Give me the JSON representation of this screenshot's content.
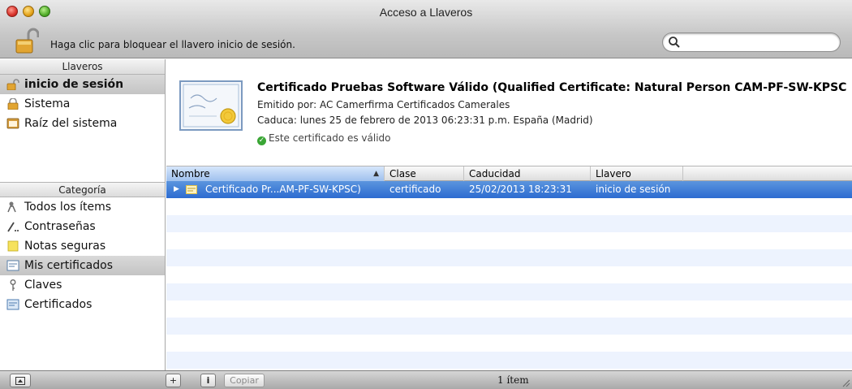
{
  "window": {
    "title": "Acceso a Llaveros"
  },
  "toolbar": {
    "lock_label": "Haga clic para bloquear el llavero inicio de sesión.",
    "search_placeholder": ""
  },
  "sidebar": {
    "keychains_header": "Llaveros",
    "keychains": [
      {
        "label": "inicio de sesión",
        "icon": "open-lock-icon",
        "selected": true
      },
      {
        "label": "Sistema",
        "icon": "lock-icon"
      },
      {
        "label": "Raíz del sistema",
        "icon": "cabinet-icon"
      }
    ],
    "category_header": "Categoría",
    "categories": [
      {
        "label": "Todos los ítems",
        "icon": "people-icon"
      },
      {
        "label": "Contraseñas",
        "icon": "password-icon"
      },
      {
        "label": "Notas seguras",
        "icon": "note-icon"
      },
      {
        "label": "Mis certificados",
        "icon": "certificate-icon",
        "selected": true
      },
      {
        "label": "Claves",
        "icon": "key-icon"
      },
      {
        "label": "Certificados",
        "icon": "certificate-icon"
      }
    ]
  },
  "detail": {
    "title": "Certificado Pruebas Software Válido (Qualified Certificate: Natural Person CAM-PF-SW-KPSC",
    "issuer": "Emitido por: AC Camerfirma Certificados Camerales",
    "expires": "Caduca: lunes 25 de febrero de 2013 06:23:31 p.m. España (Madrid)",
    "validity": "Este certificado es válido"
  },
  "table": {
    "columns": [
      "Nombre",
      "Clase",
      "Caducidad",
      "Llavero"
    ],
    "sorted_column": "Nombre",
    "rows": [
      {
        "name": "Certificado Pr...AM-PF-SW-KPSC)",
        "class": "certificado",
        "expiry": "25/02/2013 18:23:31",
        "keychain": "inicio de sesión",
        "selected": true
      }
    ]
  },
  "bottombar": {
    "add_label": "+",
    "info_label": "i",
    "copy_label": "Copiar",
    "count": "1 ítem"
  },
  "colors": {
    "selection": "#3b7bd6",
    "alt_row": "#edf3fe"
  }
}
